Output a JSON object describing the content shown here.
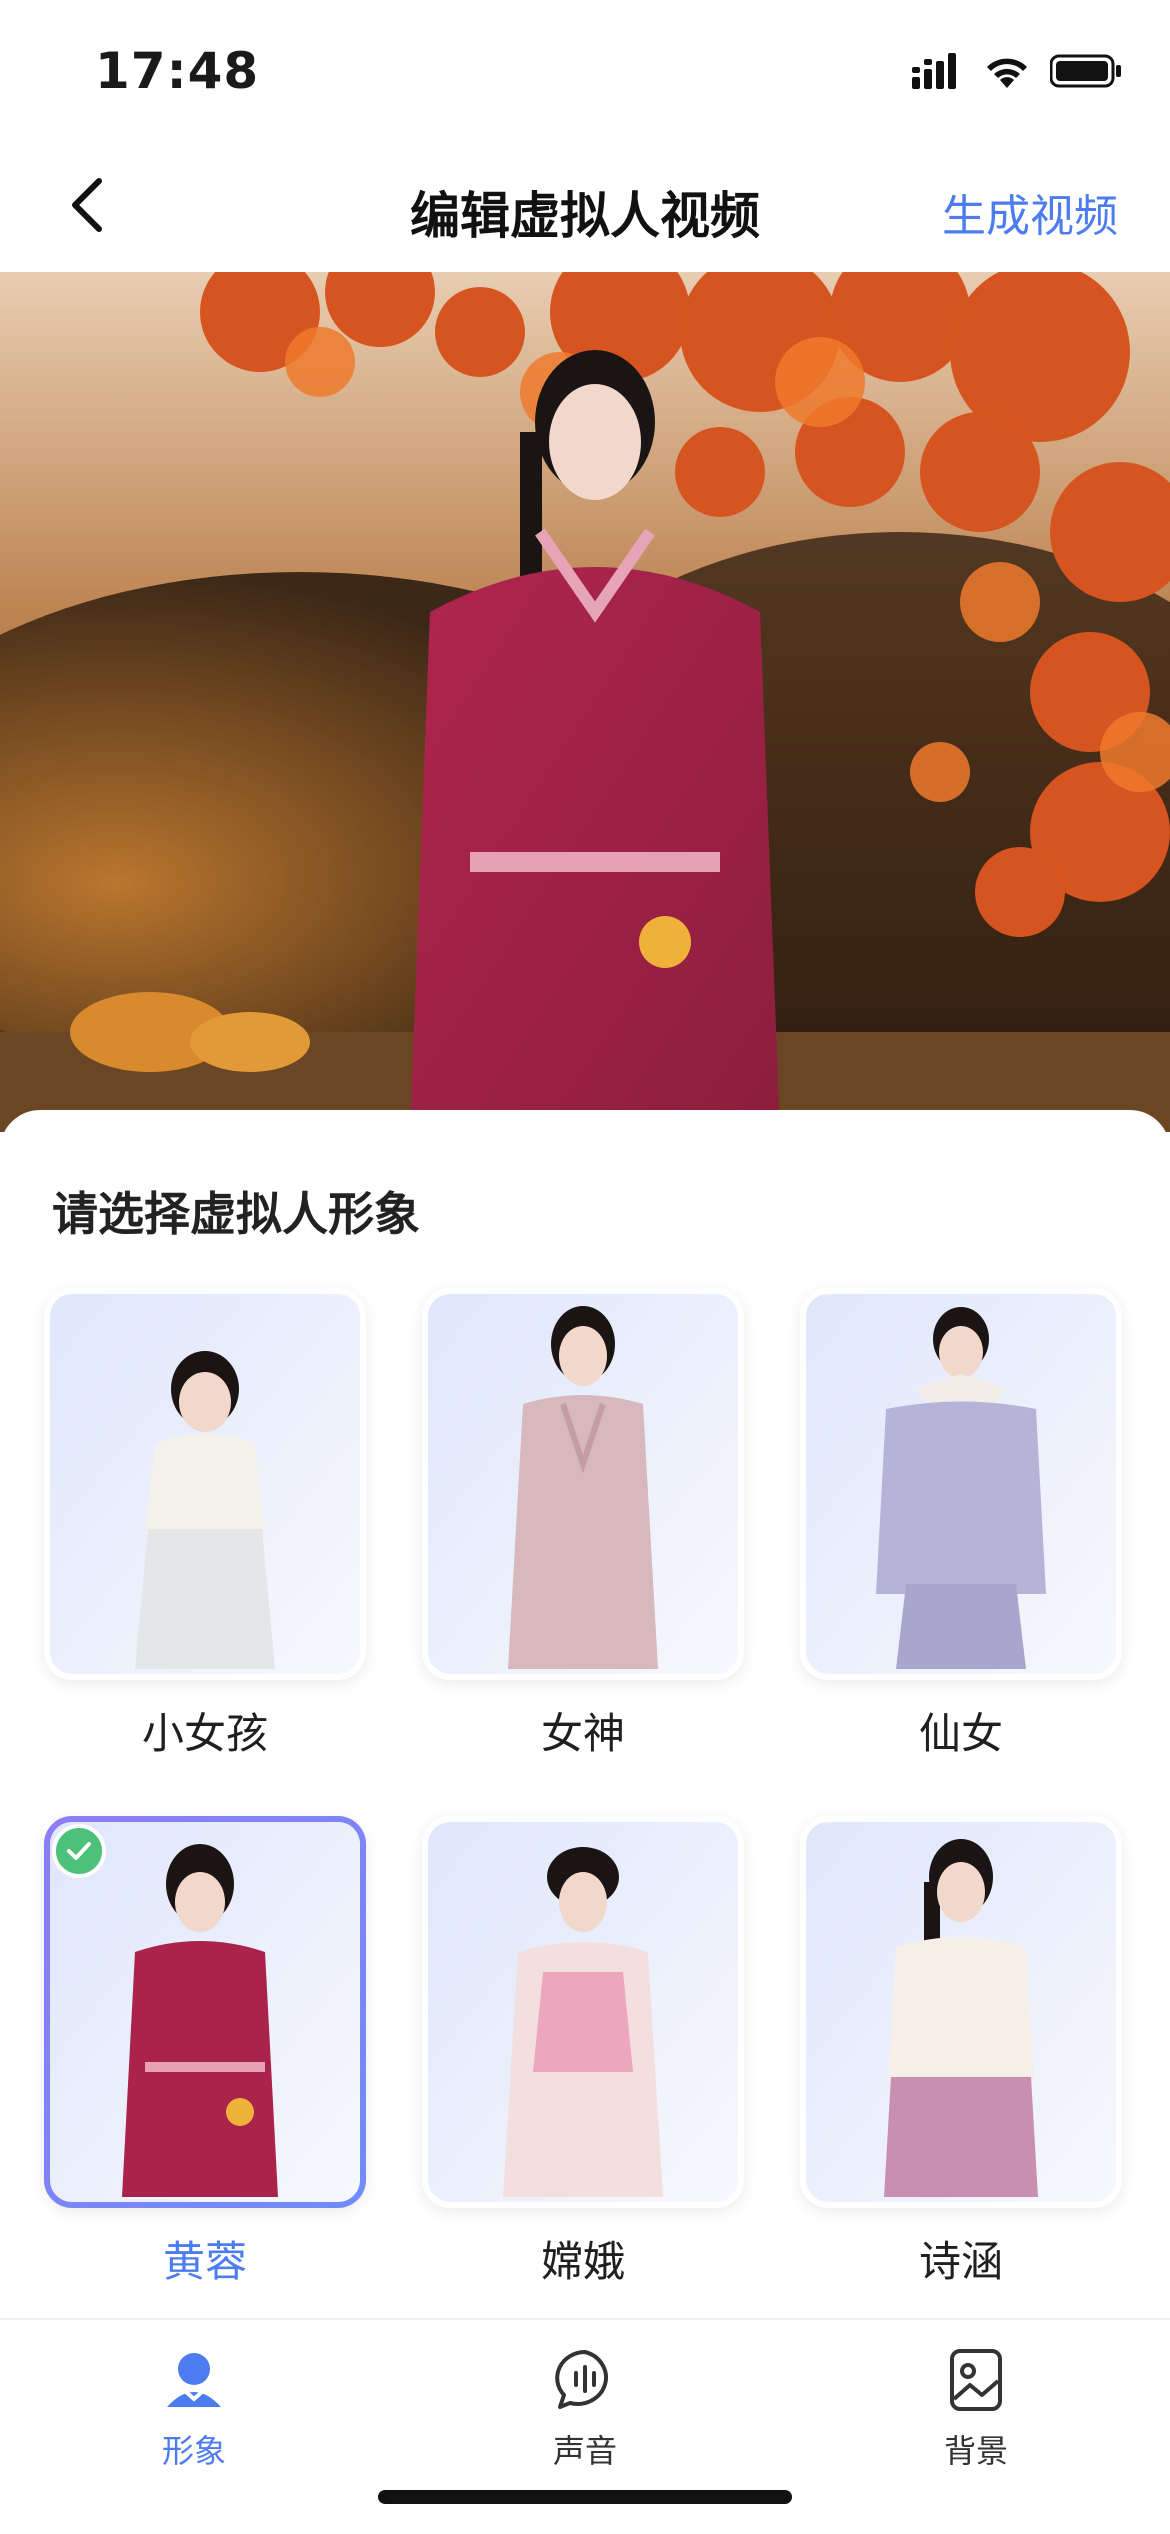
{
  "status_bar": {
    "time": "17:48"
  },
  "nav": {
    "title": "编辑虚拟人视频",
    "action": "生成视频"
  },
  "sheet": {
    "title": "请选择虚拟人形象",
    "avatars": [
      {
        "label": "小女孩",
        "selected": false
      },
      {
        "label": "女神",
        "selected": false
      },
      {
        "label": "仙女",
        "selected": false
      },
      {
        "label": "黄蓉",
        "selected": true
      },
      {
        "label": "嫦娥",
        "selected": false
      },
      {
        "label": "诗涵",
        "selected": false
      }
    ]
  },
  "tabs": [
    {
      "label": "形象",
      "icon": "person-icon",
      "active": true
    },
    {
      "label": "声音",
      "icon": "voice-bubble-icon",
      "active": false
    },
    {
      "label": "背景",
      "icon": "image-icon",
      "active": false
    }
  ],
  "colors": {
    "accent": "#4d7cf0",
    "check": "#4cc17a"
  }
}
